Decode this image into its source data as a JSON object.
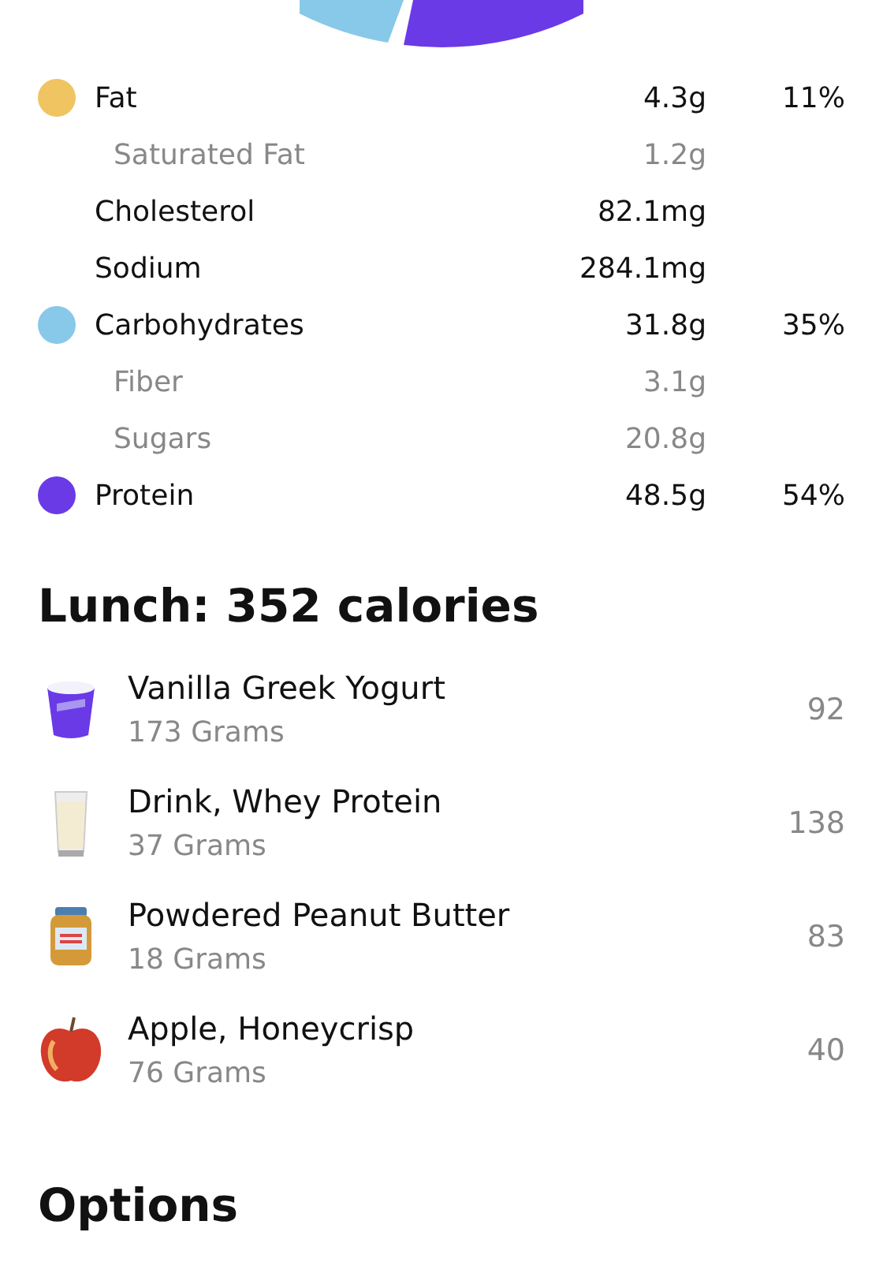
{
  "nutrients": [
    {
      "kind": "macro",
      "name": "Fat",
      "amount": "4.3g",
      "percent": "11%",
      "color": "#f0c460"
    },
    {
      "kind": "sub",
      "name": "Saturated Fat",
      "amount": "1.2g"
    },
    {
      "kind": "plain",
      "name": "Cholesterol",
      "amount": "82.1mg"
    },
    {
      "kind": "plain",
      "name": "Sodium",
      "amount": "284.1mg"
    },
    {
      "kind": "macro",
      "name": "Carbohydrates",
      "amount": "31.8g",
      "percent": "35%",
      "color": "#88c8e8"
    },
    {
      "kind": "sub",
      "name": "Fiber",
      "amount": "3.1g"
    },
    {
      "kind": "sub",
      "name": "Sugars",
      "amount": "20.8g"
    },
    {
      "kind": "macro",
      "name": "Protein",
      "amount": "48.5g",
      "percent": "54%",
      "color": "#6a3ae6"
    }
  ],
  "meal": {
    "title": "Lunch: 352 calories",
    "foods": [
      {
        "kind": "cup",
        "name": "Vanilla Greek Yogurt",
        "portion": "173 Grams",
        "calories": "92"
      },
      {
        "kind": "glass",
        "name": "Drink, Whey Protein",
        "portion": "37 Grams",
        "calories": "138"
      },
      {
        "kind": "jar",
        "name": "Powdered Peanut Butter",
        "portion": "18 Grams",
        "calories": "83"
      },
      {
        "kind": "apple",
        "name": "Apple, Honeycrisp",
        "portion": "76 Grams",
        "calories": "40"
      }
    ]
  },
  "options": {
    "title": "Options"
  }
}
